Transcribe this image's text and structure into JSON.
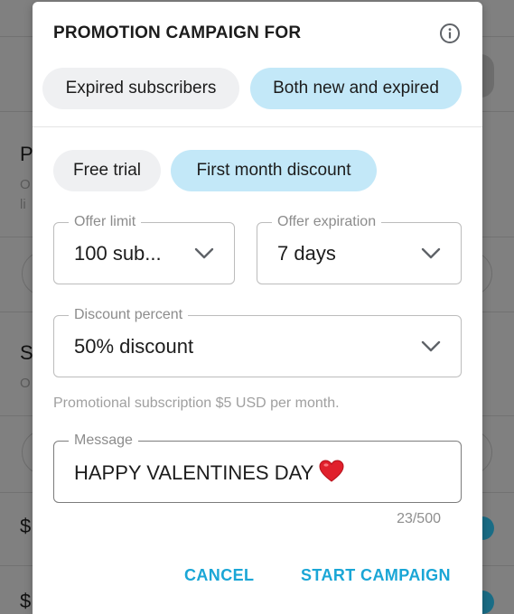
{
  "background": {
    "row_initials": [
      "P",
      "S",
      "$",
      "$"
    ],
    "sub_initials": [
      "O",
      "li",
      "O"
    ]
  },
  "dialog": {
    "title": "PROMOTION CAMPAIGN FOR",
    "info_icon": "info-icon",
    "audience_options": [
      {
        "label": "Expired subscribers",
        "selected": false
      },
      {
        "label": "Both new and expired",
        "selected": true
      }
    ],
    "offer_types": [
      {
        "label": "Free trial",
        "selected": false
      },
      {
        "label": "First month discount",
        "selected": true
      }
    ],
    "offer_limit": {
      "label": "Offer limit",
      "value": "100 sub..."
    },
    "offer_expiration": {
      "label": "Offer expiration",
      "value": "7 days"
    },
    "discount_percent": {
      "label": "Discount percent",
      "value": "50% discount"
    },
    "helper_text": "Promotional subscription $5 USD per month.",
    "message": {
      "label": "Message",
      "value": "HAPPY VALENTINES DAY",
      "emoji": "heart-icon"
    },
    "counter": "23/500",
    "cancel_label": "CANCEL",
    "start_label": "START CAMPAIGN",
    "colors": {
      "accent": "#1aa6d6",
      "chip_selected": "#c3e8f8",
      "chip": "#eff0f2"
    }
  }
}
